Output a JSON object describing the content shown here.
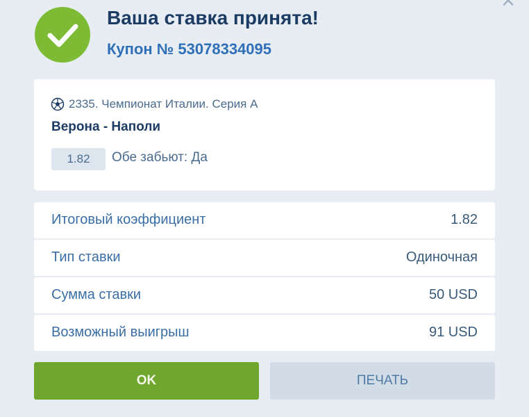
{
  "dialog": {
    "close_symbol": "×",
    "title": "Ваша ставка принята!",
    "coupon": "Купон № 53078334095",
    "icons": {
      "status": "check-icon",
      "sport": "soccer-ball-icon",
      "close": "close-icon"
    },
    "colors": {
      "success": "#7dbb35",
      "title": "#1c3c64",
      "accent": "#2e6fb7",
      "ok_button": "#6fa72e",
      "secondary_button": "#d2dce7"
    }
  },
  "event": {
    "league": "2335. Чемпионат Италии. Серия А",
    "match": "Верона - Наполи",
    "odds": "1.82",
    "outcome": "Обе забьют: Да"
  },
  "summary": [
    {
      "label": "Итоговый коэффициент",
      "value": "1.82"
    },
    {
      "label": "Тип ставки",
      "value": "Одиночная"
    },
    {
      "label": "Сумма ставки",
      "value": "50 USD"
    },
    {
      "label": "Возможный выигрыш",
      "value": "91 USD"
    }
  ],
  "buttons": {
    "ok": "OK",
    "print": "ПЕЧАТЬ"
  }
}
